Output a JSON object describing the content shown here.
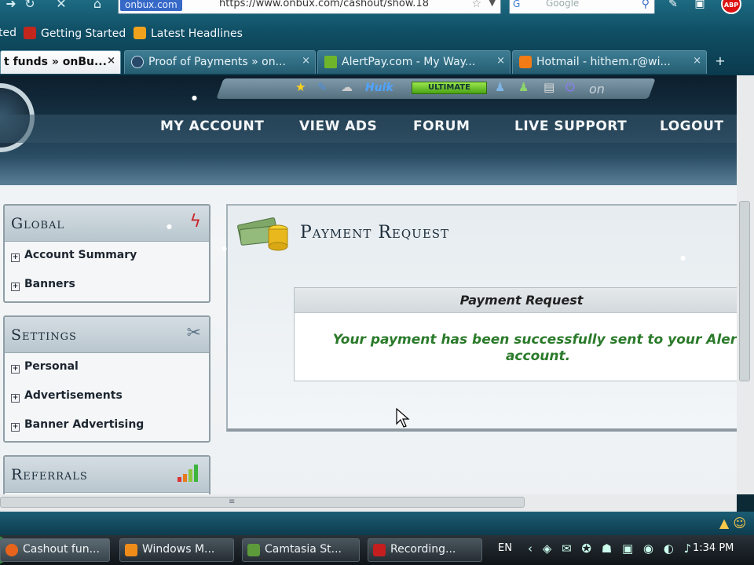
{
  "browser": {
    "url_site": "onbux.com",
    "url": "https://www.onbux.com/cashout/show.18",
    "search_engine": "G",
    "search_placeholder": "Google",
    "bookmarks": [
      "ted",
      "Getting Started",
      "Latest Headlines"
    ],
    "tabs": [
      {
        "label": "t funds » onBu...",
        "active": true
      },
      {
        "label": "Proof of Payments » on...",
        "active": false
      },
      {
        "label": "AlertPay.com - My Way...",
        "active": false
      },
      {
        "label": "Hotmail - hithem.r@wi...",
        "active": false
      }
    ],
    "new_tab": "+",
    "close_glyph": "×"
  },
  "header": {
    "hulk": "Hulk",
    "ultimate": "ULTIMATE",
    "logo_small": "on",
    "nav": [
      "MY ACCOUNT",
      "VIEW ADS",
      "FORUM",
      "LIVE SUPPORT",
      "LOGOUT"
    ]
  },
  "sidebar": {
    "global": {
      "title": "Global",
      "items": [
        "Account Summary",
        "Banners"
      ]
    },
    "settings": {
      "title": "Settings",
      "items": [
        "Personal",
        "Advertisements",
        "Banner Advertising"
      ]
    },
    "referrals": {
      "title": "Referrals"
    }
  },
  "main": {
    "title": "Payment Request",
    "notice_title": "Payment Request",
    "notice_message": "Your payment has been successfully sent to your Alert account."
  },
  "taskbar": {
    "items": [
      "Cashout fun...",
      "Windows M...",
      "Camtasia St...",
      "Recording..."
    ],
    "lang": "EN",
    "clock": "1:34 PM"
  },
  "colors": {
    "success_text": "#2a7a2a",
    "header_dark": "#0c1e2c",
    "ultimate_green": "#4aa314"
  }
}
